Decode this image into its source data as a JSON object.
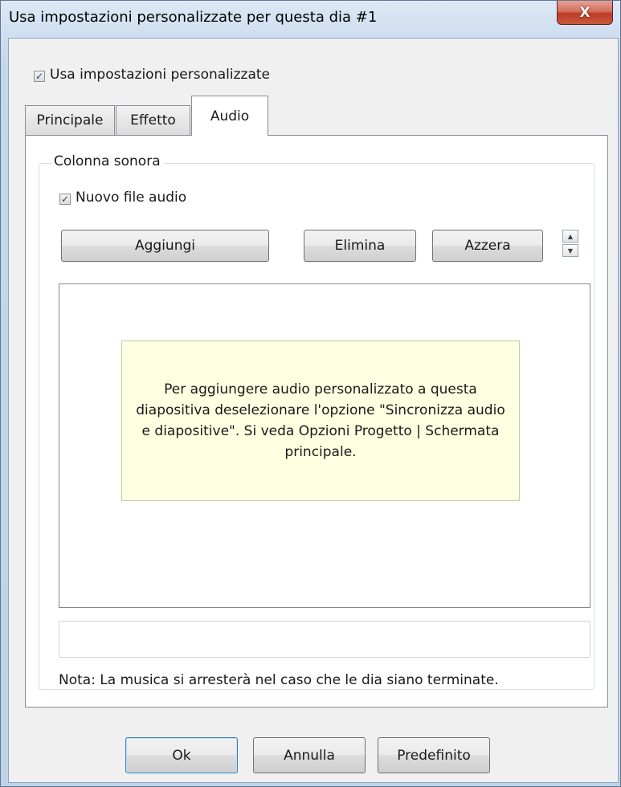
{
  "window": {
    "title": "Usa impostazioni personalizzate per questa dia #1",
    "close_glyph": "X"
  },
  "custom_settings": {
    "label": "Usa impostazioni personalizzate",
    "checked": true
  },
  "tabs": [
    {
      "label": "Principale",
      "active": false
    },
    {
      "label": "Effetto",
      "active": false
    },
    {
      "label": "Audio",
      "active": true
    }
  ],
  "soundtrack": {
    "group_title": "Colonna sonora",
    "new_audio_label": "Nuovo file audio",
    "new_audio_checked": true,
    "add_label": "Aggiungi",
    "delete_label": "Elimina",
    "reset_label": "Azzera",
    "tooltip_text": "Per aggiungere audio personalizzato a questa diapositiva deselezionare l'opzione \"Sincronizza audio e diapositive\". Si veda Opzioni Progetto | Schermata principale.",
    "file_value": "",
    "note": "Nota: La musica si arresterà nel caso che le dia siano terminate."
  },
  "footer": {
    "ok_label": "Ok",
    "cancel_label": "Annulla",
    "default_label": "Predefinito"
  },
  "icons": {
    "check": "check-icon",
    "spin_up": "arrow-up-icon",
    "spin_down": "arrow-down-icon",
    "close": "close-icon"
  }
}
